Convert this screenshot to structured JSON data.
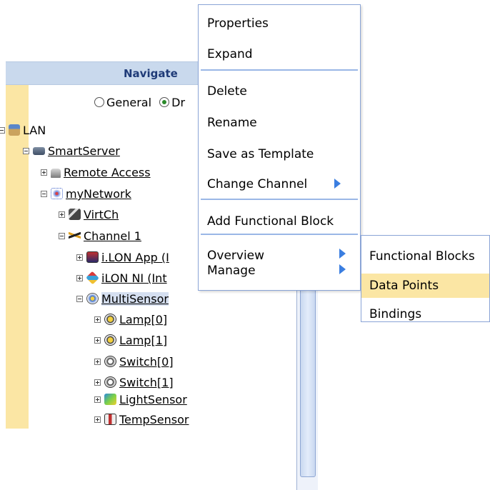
{
  "navigator": {
    "header": "Navigate",
    "radio_general": "General",
    "radio_driver_partial": "Dr"
  },
  "tree": {
    "lan": "LAN",
    "smartserver": "SmartServer",
    "remote_access": "Remote Access",
    "mynetwork": "myNetwork",
    "virtch": "VirtCh",
    "channel1": "Channel 1",
    "ilon_app": "i.LON App (I",
    "ilon_ni": "iLON NI (Int",
    "multisensor": "MultiSensor",
    "lamp0": "Lamp[0]",
    "lamp1": "Lamp[1]",
    "switch0": "Switch[0]",
    "switch1": "Switch[1]",
    "lightsensor": "LightSensor",
    "tempsensor": "TempSensor"
  },
  "context_menu": {
    "properties": "Properties",
    "expand": "Expand",
    "delete": "Delete",
    "rename": "Rename",
    "save_template": "Save as Template",
    "change_channel": "Change Channel",
    "add_fb": "Add Functional Block",
    "overview": "Overview",
    "manage": "Manage"
  },
  "submenu": {
    "functional_blocks": "Functional Blocks",
    "data_points": "Data Points",
    "bindings": "Bindings"
  },
  "colors": {
    "accent_arrow": "#3b7ee0",
    "highlight": "#fbe6a4",
    "header_bg": "#c9d9ed",
    "separator": "#9ab7e6"
  }
}
